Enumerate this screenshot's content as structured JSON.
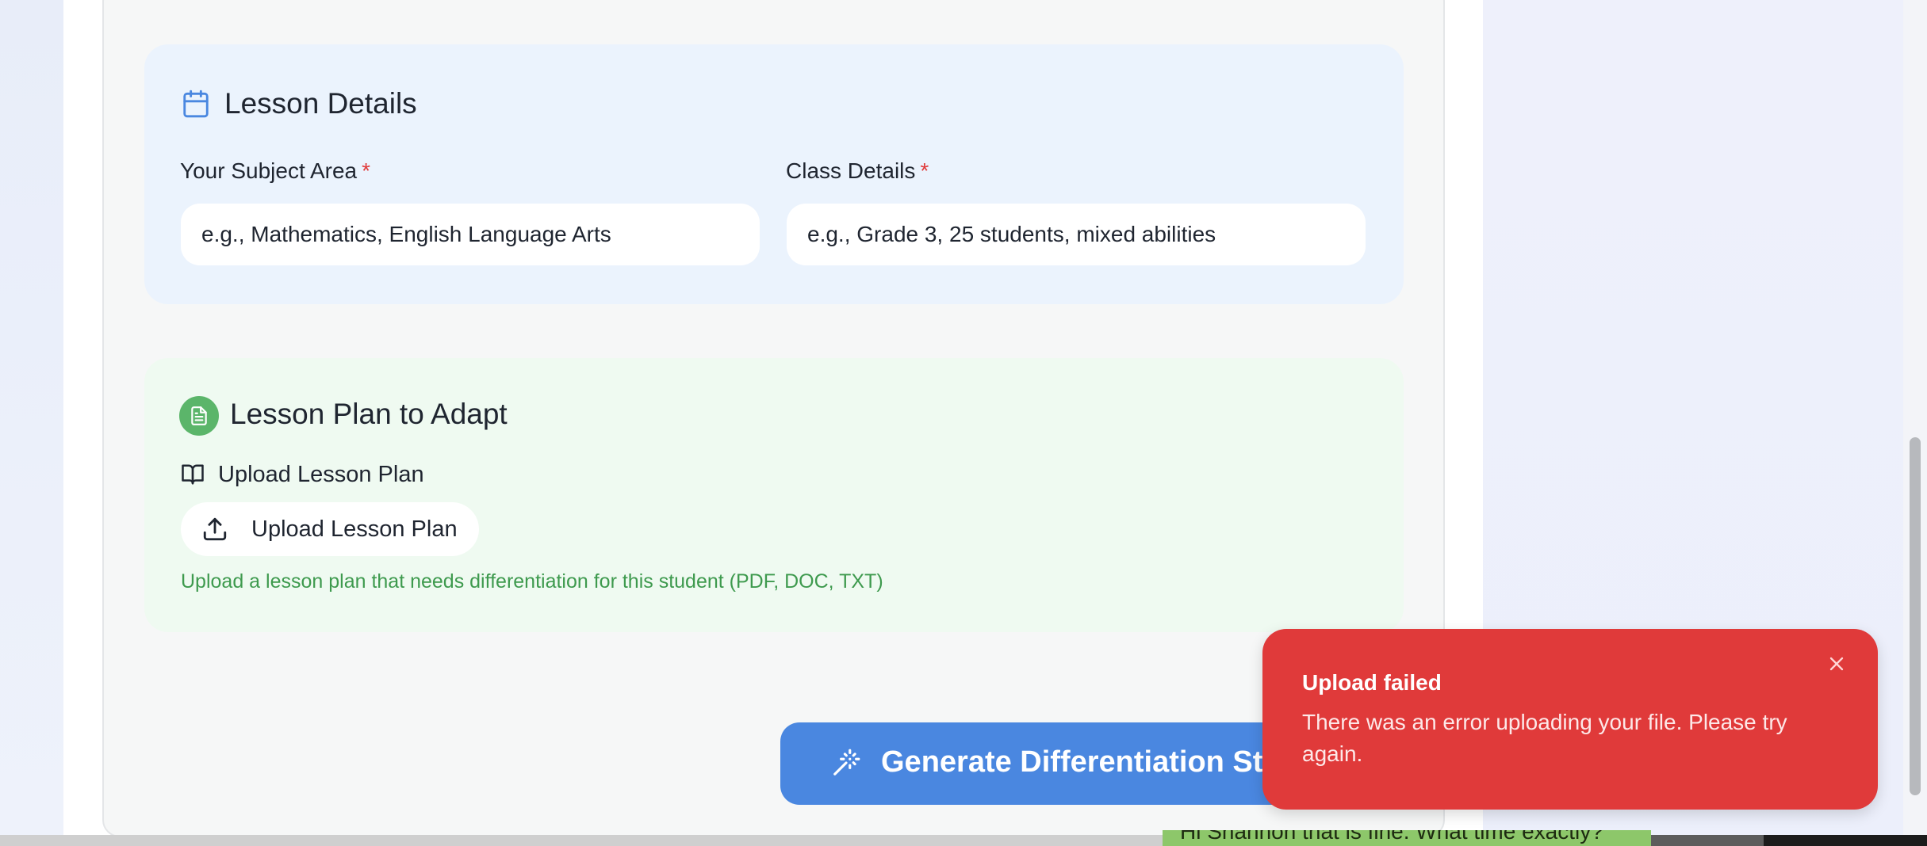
{
  "lesson_details": {
    "title": "Lesson Details",
    "subject": {
      "label": "Your Subject Area",
      "required_mark": "*",
      "placeholder": "e.g., Mathematics, English Language Arts"
    },
    "class": {
      "label": "Class Details",
      "required_mark": "*",
      "placeholder": "e.g., Grade 3, 25 students, mixed abilities"
    }
  },
  "lesson_plan": {
    "title": "Lesson Plan to Adapt",
    "upload_label": "Upload Lesson Plan",
    "upload_button": "Upload Lesson Plan",
    "hint": "Upload a lesson plan that needs differentiation for this student (PDF, DOC, TXT)"
  },
  "generate_button": "Generate Differentiation Stra",
  "toast": {
    "title": "Upload failed",
    "message": "There was an error uploading your file. Please try again."
  },
  "background_window": {
    "text": "Hi Shannon that is fine. What time exactly?"
  },
  "colors": {
    "accent": "#4a87e0",
    "error": "#e03a3a",
    "success": "#5bb56a",
    "details_bg": "#ebf3fd",
    "plan_bg": "#effaf1"
  },
  "icons": {
    "lesson_details": "calendar-icon",
    "lesson_plan": "document-icon",
    "upload_label": "book-open-icon",
    "upload_button": "upload-icon",
    "generate": "magic-wand-icon",
    "toast_close": "close-icon"
  }
}
